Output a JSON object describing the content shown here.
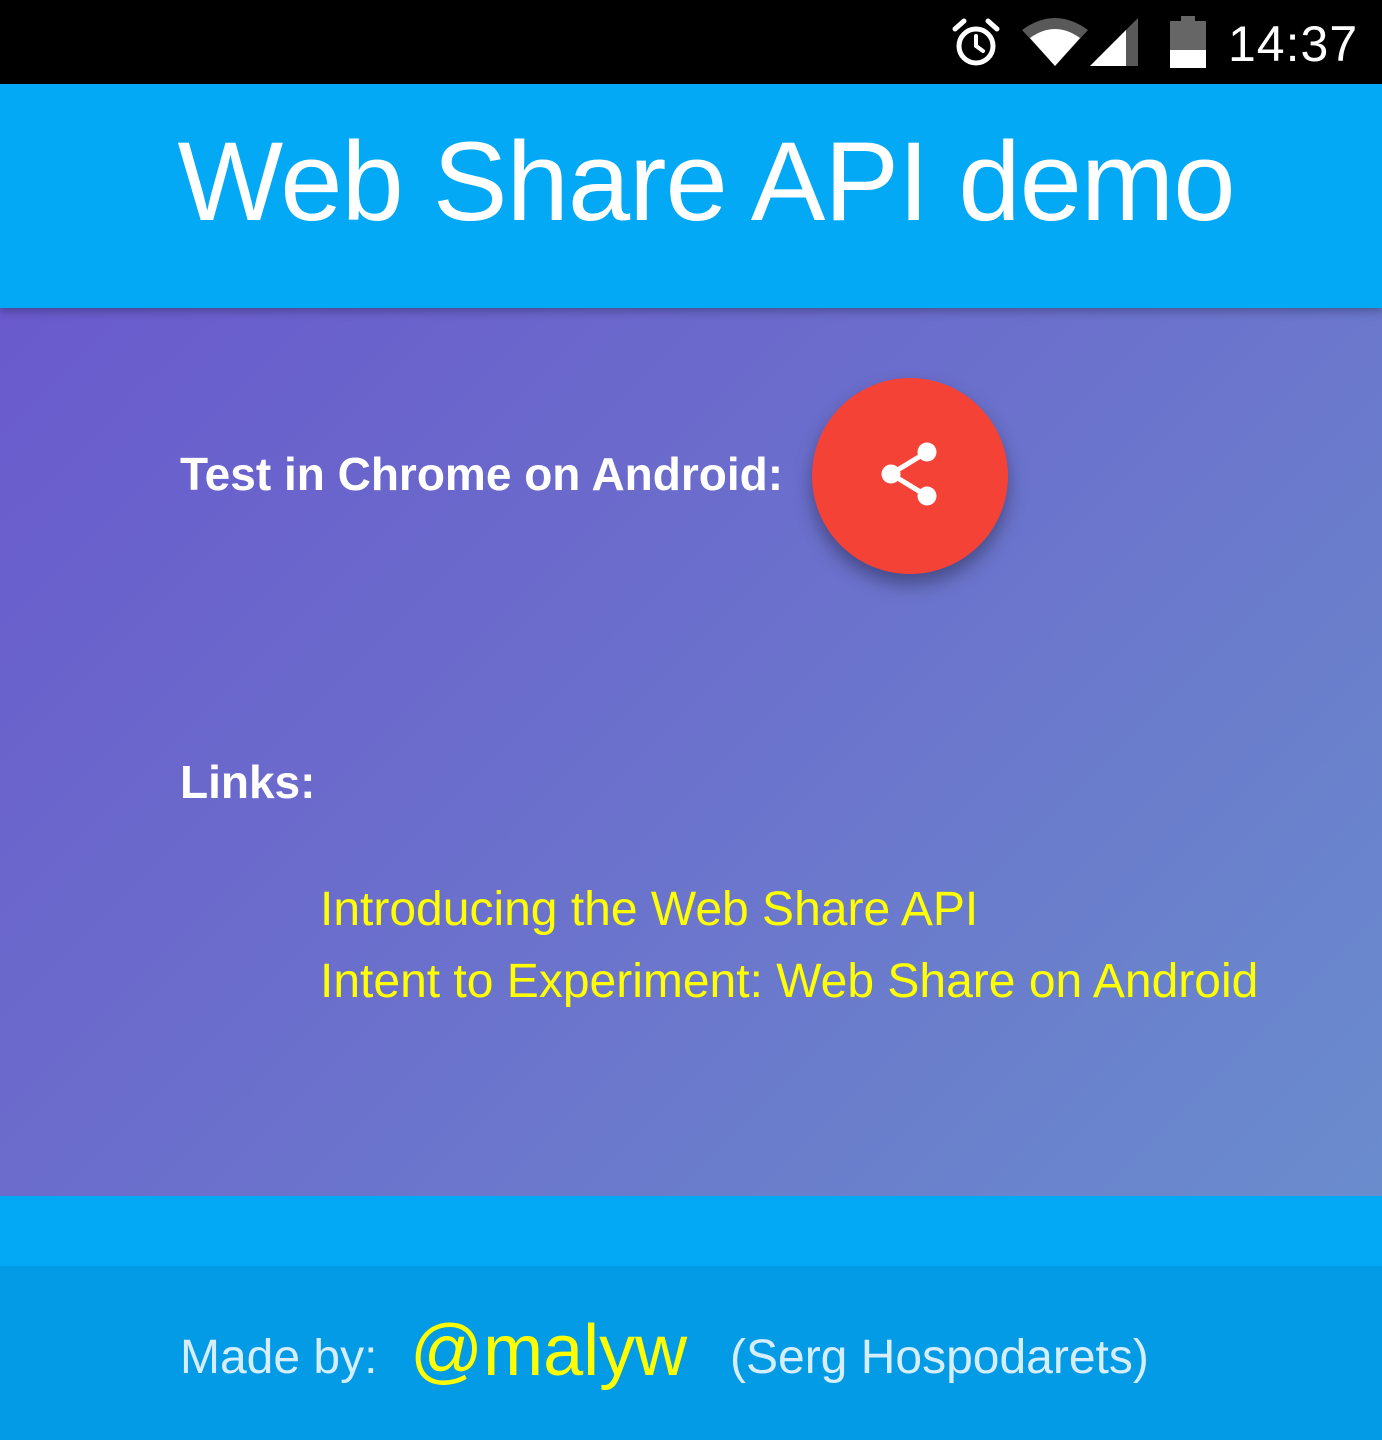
{
  "status_bar": {
    "time": "14:37",
    "icons": [
      "alarm-icon",
      "wifi-icon",
      "cell-signal-icon",
      "battery-icon"
    ]
  },
  "header": {
    "title": "Web Share API demo"
  },
  "main": {
    "test_label": "Test in Chrome on Android:",
    "share_button_icon": "share-icon",
    "links_heading": "Links:",
    "links": [
      {
        "label": "Introducing the Web Share API"
      },
      {
        "label": "Intent to Experiment: Web Share on Android"
      }
    ]
  },
  "footer": {
    "made_by_label": "Made by:",
    "handle": "@malyw",
    "author": "(Serg Hospodarets)"
  },
  "colors": {
    "header_blue": "#03a9f4",
    "footer_blue": "#039be5",
    "gradient_start": "#6a5acd",
    "gradient_end": "#6a8ccd",
    "share_button_red": "#f44336",
    "link_yellow": "#ffff00"
  }
}
